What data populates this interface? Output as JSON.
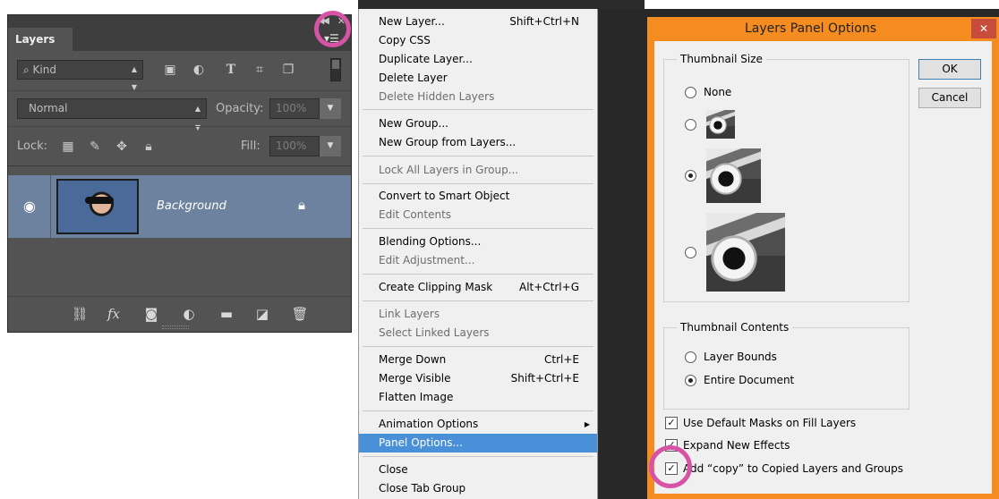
{
  "accent_colors": {
    "highlight_ring": "#d653a6",
    "dialog_border": "#f58c1f",
    "menu_selection": "#4a90d9",
    "layer_selection": "#6c829e"
  },
  "layers_panel": {
    "collapse_icon": "double-chevron-left",
    "close_icon": "close-x",
    "tab_label": "Layers",
    "menu_icon": "panel-menu",
    "filter": {
      "kind_label": "Kind",
      "icons": [
        "image-filter",
        "adjustment-filter",
        "type-filter",
        "shape-filter",
        "smart-object-filter"
      ]
    },
    "blend_mode": "Normal",
    "opacity_label": "Opacity:",
    "opacity_value": "100%",
    "lock_label": "Lock:",
    "lock_icons": [
      "lock-transparent-pixels",
      "lock-image-pixels",
      "lock-position",
      "lock-all"
    ],
    "fill_label": "Fill:",
    "fill_value": "100%",
    "layer": {
      "name": "Background",
      "visible_icon": "eye",
      "lock_icon": "lock"
    },
    "bottom_icons": [
      "link-layers",
      "fx-styles",
      "add-mask",
      "new-adjustment",
      "new-group",
      "new-layer",
      "delete-layer"
    ]
  },
  "menu": {
    "items": [
      {
        "label": "New Layer...",
        "shortcut": "Shift+Ctrl+N",
        "disabled": false
      },
      {
        "label": "Copy CSS",
        "shortcut": "",
        "disabled": false
      },
      {
        "label": "Duplicate Layer...",
        "shortcut": "",
        "disabled": false
      },
      {
        "label": "Delete Layer",
        "shortcut": "",
        "disabled": false
      },
      {
        "label": "Delete Hidden Layers",
        "shortcut": "",
        "disabled": true
      },
      {
        "label": "New Group...",
        "shortcut": "",
        "disabled": false
      },
      {
        "label": "New Group from Layers...",
        "shortcut": "",
        "disabled": false
      },
      {
        "label": "Lock All Layers in Group...",
        "shortcut": "",
        "disabled": true
      },
      {
        "label": "Convert to Smart Object",
        "shortcut": "",
        "disabled": false
      },
      {
        "label": "Edit Contents",
        "shortcut": "",
        "disabled": true
      },
      {
        "label": "Blending Options...",
        "shortcut": "",
        "disabled": false
      },
      {
        "label": "Edit Adjustment...",
        "shortcut": "",
        "disabled": true
      },
      {
        "label": "Create Clipping Mask",
        "shortcut": "Alt+Ctrl+G",
        "disabled": false
      },
      {
        "label": "Link Layers",
        "shortcut": "",
        "disabled": true
      },
      {
        "label": "Select Linked Layers",
        "shortcut": "",
        "disabled": true
      },
      {
        "label": "Merge Down",
        "shortcut": "Ctrl+E",
        "disabled": false
      },
      {
        "label": "Merge Visible",
        "shortcut": "Shift+Ctrl+E",
        "disabled": false
      },
      {
        "label": "Flatten Image",
        "shortcut": "",
        "disabled": false
      },
      {
        "label": "Animation Options",
        "shortcut": "",
        "disabled": false,
        "submenu": true
      },
      {
        "label": "Panel Options...",
        "shortcut": "",
        "disabled": false,
        "selected": true
      },
      {
        "label": "Close",
        "shortcut": "",
        "disabled": false
      },
      {
        "label": "Close Tab Group",
        "shortcut": "",
        "disabled": false
      }
    ]
  },
  "dialog": {
    "title": "Layers Panel Options",
    "close_icon": "close-x",
    "thumbnail_size": {
      "legend": "Thumbnail Size",
      "options": [
        {
          "label": "None",
          "selected": false
        },
        {
          "label": "",
          "selected": false,
          "size": "small"
        },
        {
          "label": "",
          "selected": true,
          "size": "medium"
        },
        {
          "label": "",
          "selected": false,
          "size": "large"
        }
      ]
    },
    "thumbnail_contents": {
      "legend": "Thumbnail Contents",
      "options": [
        {
          "label": "Layer Bounds",
          "selected": false
        },
        {
          "label": "Entire Document",
          "selected": true
        }
      ]
    },
    "checkboxes": [
      {
        "label": "Use Default Masks on Fill Layers",
        "checked": true
      },
      {
        "label": "Expand New Effects",
        "checked": true
      },
      {
        "label": "Add “copy” to Copied Layers and Groups",
        "checked": true
      }
    ],
    "ok_label": "OK",
    "cancel_label": "Cancel"
  }
}
